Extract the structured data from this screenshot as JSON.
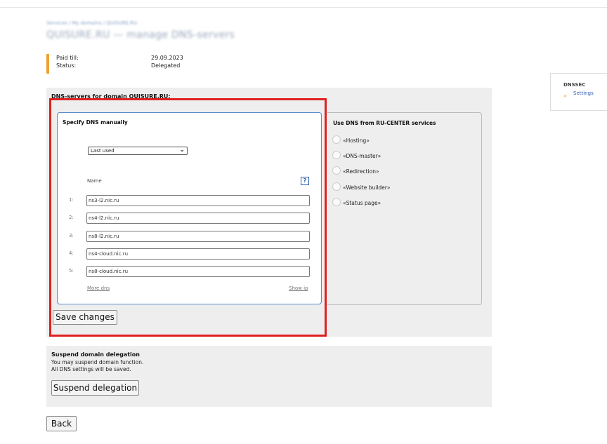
{
  "breadcrumb": "Services / My domains / QUISURE.RU",
  "page_title": "QUISURE.RU — manage DNS-servers",
  "info": {
    "paid_till_label": "Paid till:",
    "paid_till_value": "29.09.2023",
    "status_label": "Status:",
    "status_value": "Delegated"
  },
  "dns_panel": {
    "title": "DNS-servers for domain QUISURE.RU:",
    "manual": {
      "title": "Specify DNS manually",
      "select_value": "Last used",
      "name_label": "Name",
      "help_icon": "?",
      "servers": [
        {
          "num": "1:",
          "value": "ns3-l2.nic.ru"
        },
        {
          "num": "2:",
          "value": "ns4-l2.nic.ru"
        },
        {
          "num": "3:",
          "value": "ns8-l2.nic.ru"
        },
        {
          "num": "4:",
          "value": "ns4-cloud.nic.ru"
        },
        {
          "num": "5:",
          "value": "ns8-cloud.nic.ru"
        }
      ],
      "more_dns": "More dns",
      "show_ip": "Show ip"
    },
    "services": {
      "title": "Use DNS from RU-CENTER services",
      "items": [
        "«Hosting»",
        "«DNS-master»",
        "«Redirection»",
        "«Website builder»",
        "«Status page»"
      ]
    },
    "save_button": "Save changes"
  },
  "dnssec": {
    "title": "DNSSEC",
    "link": "Settings",
    "arrow_icon": "»"
  },
  "suspend": {
    "title": "Suspend domain delegation",
    "line1": "You may suspend domain function.",
    "line2": "All DNS settings will be saved.",
    "button": "Suspend delegation"
  },
  "back_button": "Back",
  "colors": {
    "accent_orange": "#f0a030",
    "highlight_red": "#e02020",
    "box_border_blue": "#5b8ac9",
    "panel_gray": "#eeeeee"
  }
}
